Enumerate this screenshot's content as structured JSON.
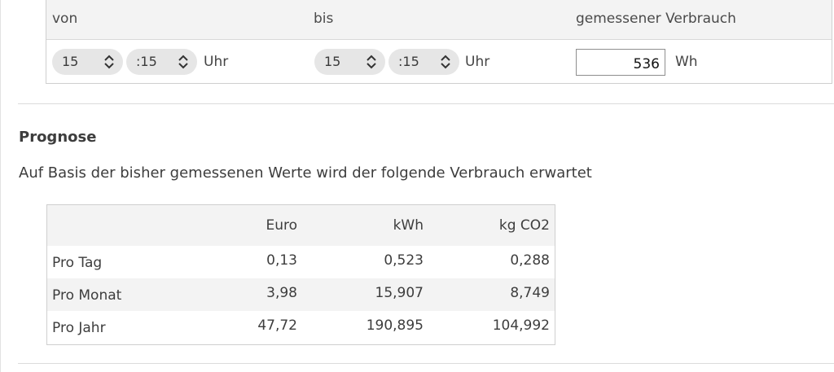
{
  "measurement": {
    "headers": {
      "from": "von",
      "to": "bis",
      "consumption": "gemessener Verbrauch"
    },
    "from": {
      "hour": "15",
      "minute": ":15",
      "unit": "Uhr"
    },
    "to": {
      "hour": "15",
      "minute": ":15",
      "unit": "Uhr"
    },
    "consumption": {
      "value": "536",
      "unit": "Wh"
    }
  },
  "forecast": {
    "title": "Prognose",
    "description": "Auf Basis der bisher gemessenen Werte wird der folgende Verbrauch erwartet",
    "columns": [
      "Euro",
      "kWh",
      "kg CO2"
    ],
    "rows": [
      {
        "label": "Pro Tag",
        "values": [
          "0,13",
          "0,523",
          "0,288"
        ]
      },
      {
        "label": "Pro Monat",
        "values": [
          "3,98",
          "15,907",
          "8,749"
        ]
      },
      {
        "label": "Pro Jahr",
        "values": [
          "47,72",
          "190,895",
          "104,992"
        ]
      }
    ]
  },
  "icons": {
    "stepper": "chevron-up-down-icon"
  },
  "colors": {
    "header_bg": "#f3f3f3",
    "pill_bg": "#e6e6e6",
    "border": "#cfcfcf",
    "text": "#3d3d3d"
  }
}
